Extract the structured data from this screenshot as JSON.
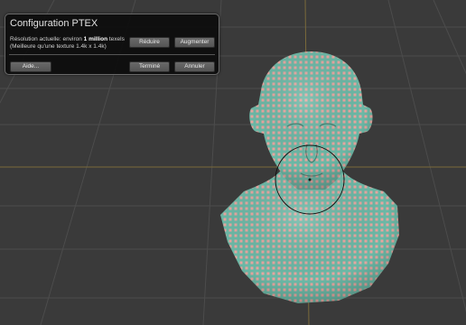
{
  "dialog": {
    "title": "Configuration PTEX",
    "info_prefix": "Résolution actuelle: environ ",
    "info_bold": "1 million",
    "info_suffix": " texels",
    "info_line2": "(Meilleure qu'une texture 1.4k x 1.4k)",
    "buttons": {
      "reduce": "Réduire",
      "increase": "Augmenter",
      "help": "Aide...",
      "done": "Terminé",
      "cancel": "Annuler"
    }
  },
  "viewport": {
    "model": "head-bust",
    "colors": {
      "background": "#3a3a3a",
      "grid": "#4c4c4c",
      "axis": "#7a6a3a",
      "mesh_teal": "#6bb8a6",
      "mesh_dots": "#e8a6a0",
      "brush_circle": "#111111"
    }
  }
}
